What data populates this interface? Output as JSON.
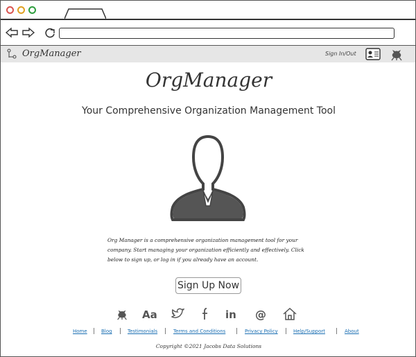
{
  "browser": {
    "url_value": "",
    "icons": [
      "back-arrow-icon",
      "forward-arrow-icon",
      "reload-icon"
    ]
  },
  "header": {
    "brand": "OrgManager",
    "sign_link": "Sign In/Out",
    "icons": [
      "org-tree-icon",
      "profile-card-icon",
      "github-octocat-icon"
    ]
  },
  "main": {
    "title": "OrgManager",
    "subtitle": "Your Comprehensive Organization Management Tool",
    "hero_icon": "person-silhouette-icon",
    "intro_lines": [
      "Org Manager is a comprehensive organization management tool for your",
      "company.  Start managing your organization efficiently and effectively.  Click",
      "below to sign up, or log in if you already have an account."
    ],
    "signup_label": "Sign Up Now"
  },
  "social": [
    "github-icon",
    "font-icon",
    "twitter-icon",
    "facebook-icon",
    "linkedin-icon",
    "at-sign-icon",
    "home-icon"
  ],
  "footer": {
    "links": [
      "Home",
      "Blog",
      "Testimonials",
      "Terms and Conditions",
      "Privacy Policy",
      "Help/Support",
      "About"
    ],
    "copyright": "Copyright ©2021 Jacobs Data Solutions"
  },
  "colors": {
    "header_bg": "#e6e6e6",
    "link": "#1b6fb3",
    "dot_red": "#d9534f",
    "dot_yellow": "#e0a020",
    "dot_green": "#2e9e3e"
  }
}
